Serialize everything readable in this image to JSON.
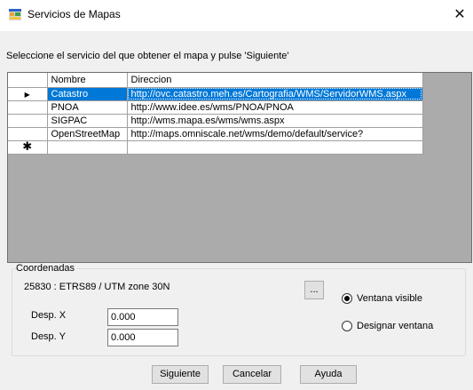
{
  "window": {
    "title": "Servicios de Mapas",
    "close_glyph": "✕",
    "icon": "map-app-icon"
  },
  "instruction": "Seleccione el servicio del que obtener el mapa y pulse 'Siguiente'",
  "grid": {
    "columns": [
      "Nombre",
      "Direccion"
    ],
    "rows": [
      {
        "nombre": "Catastro",
        "direccion": "http://ovc.catastro.meh.es/Cartografia/WMS/ServidorWMS.aspx",
        "selected": true
      },
      {
        "nombre": "PNOA",
        "direccion": "http://www.idee.es/wms/PNOA/PNOA",
        "selected": false
      },
      {
        "nombre": "SIGPAC",
        "direccion": "http://wms.mapa.es/wms/wms.aspx",
        "selected": false
      },
      {
        "nombre": "OpenStreetMap",
        "direccion": "http://maps.omniscale.net/wms/demo/default/service?",
        "selected": false
      }
    ],
    "current_row_glyph": "▶",
    "new_row_glyph": "✱"
  },
  "coords": {
    "legend": "Coordenadas",
    "crs": "25830 : ETRS89 / UTM zone 30N",
    "browse_label": "...",
    "desp_x_label": "Desp. X",
    "desp_x_value": "0.000",
    "desp_y_label": "Desp. Y",
    "desp_y_value": "0.000",
    "radio_visible_label": "Ventana visible",
    "radio_visible_checked": true,
    "radio_designar_label": "Designar ventana",
    "radio_designar_checked": false
  },
  "buttons": {
    "next": "Siguiente",
    "cancel": "Cancelar",
    "help": "Ayuda"
  }
}
